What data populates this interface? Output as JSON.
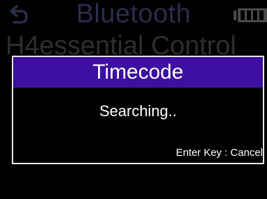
{
  "background": {
    "title": "Bluetooth",
    "menu_item": "H4essential Control",
    "back_icon": "back-arrow-icon",
    "battery_icon": "battery-icon"
  },
  "dialog": {
    "title": "Timecode",
    "message": "Searching..",
    "hint": "Enter Key : Cancel"
  },
  "colors": {
    "title_bar": "#3d0fa3",
    "background": "#000000",
    "text": "#ffffff",
    "dimmed_title": "#2c2c4c",
    "dimmed_item": "#2e2e2e"
  }
}
